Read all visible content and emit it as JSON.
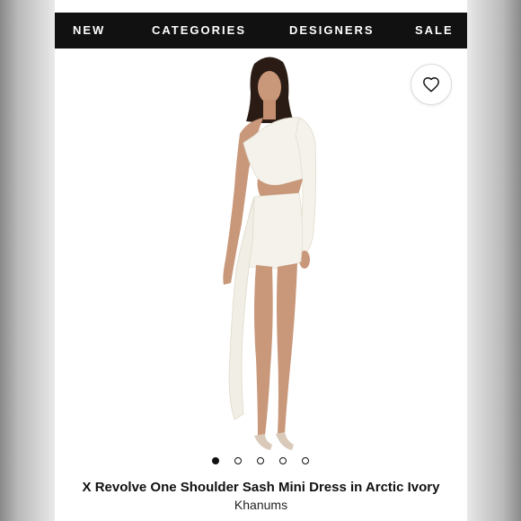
{
  "nav": {
    "items": [
      {
        "label": "NEW"
      },
      {
        "label": "CATEGORIES"
      },
      {
        "label": "DESIGNERS"
      },
      {
        "label": "SALE"
      }
    ]
  },
  "gallery": {
    "total_images": 5,
    "active_index": 0,
    "favorite_icon": "heart-outline-icon"
  },
  "product": {
    "title": "X Revolve One Shoulder Sash Mini Dress in Arctic Ivory",
    "brand": "Khanums"
  },
  "colors": {
    "nav_background": "#111111",
    "nav_text": "#ffffff",
    "dress": "#f4f2ea"
  }
}
